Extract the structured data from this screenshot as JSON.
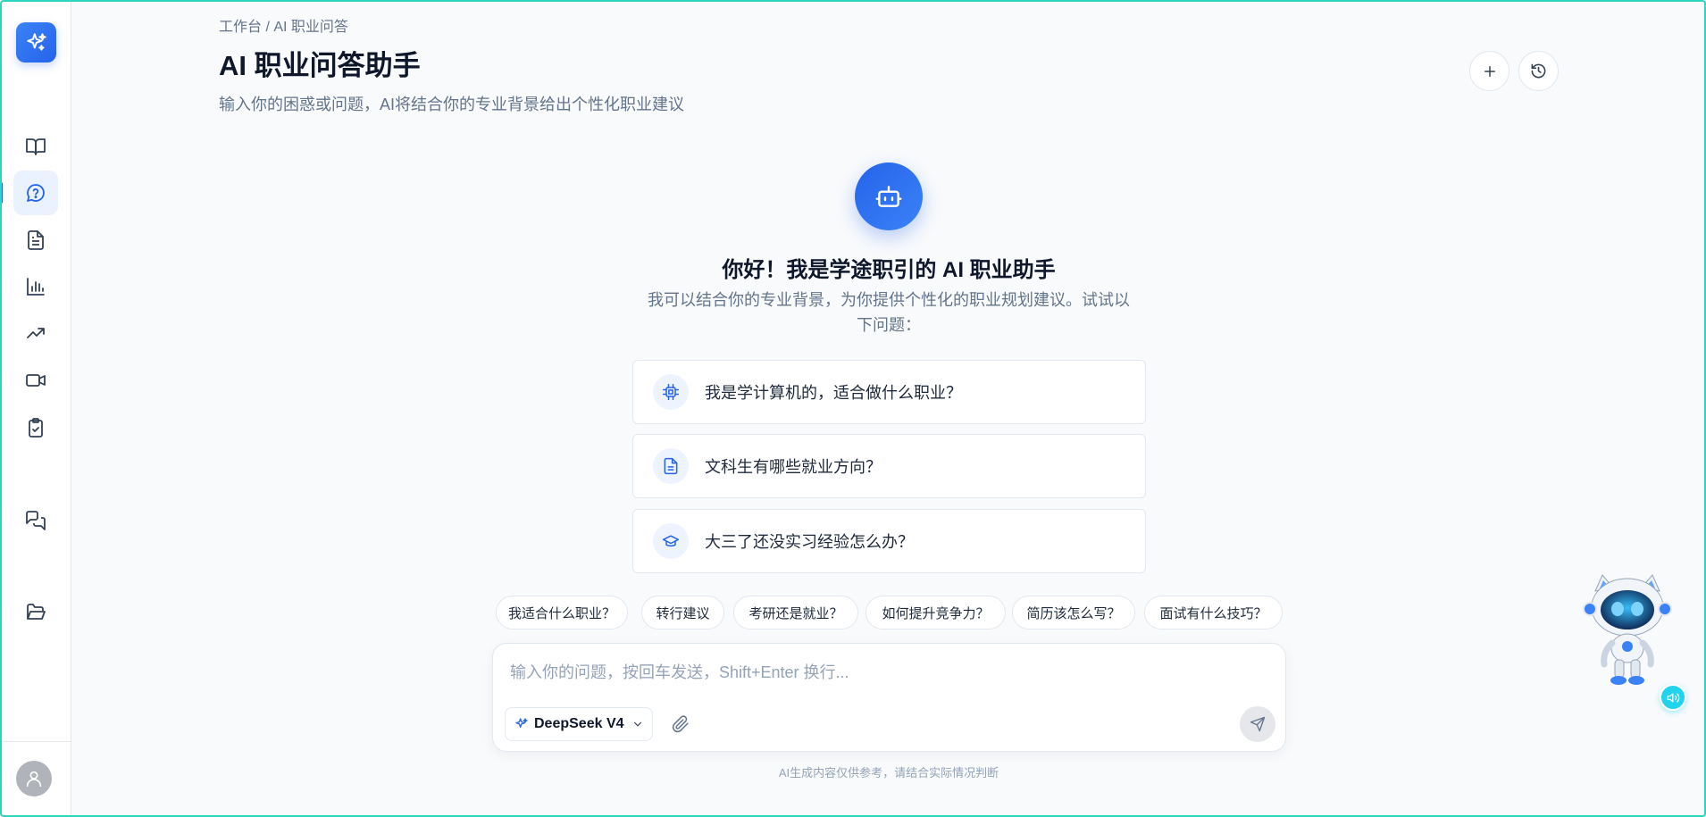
{
  "breadcrumb": "工作台 / AI 职业问答",
  "header": {
    "title": "AI 职业问答助手",
    "subtitle": "输入你的困惑或问题，AI将结合你的专业背景给出个性化职业建议"
  },
  "hero": {
    "title": "你好！我是学途职引的 AI 职业助手",
    "description": "我可以结合你的专业背景，为你提供个性化的职业规划建议。试试以下问题："
  },
  "suggestions": [
    {
      "icon": "cpu-icon",
      "text": "我是学计算机的，适合做什么职业？"
    },
    {
      "icon": "document-icon",
      "text": "文科生有哪些就业方向？"
    },
    {
      "icon": "graduation-cap-icon",
      "text": "大三了还没实习经验怎么办？"
    }
  ],
  "chips": [
    "我适合什么职业？",
    "转行建议",
    "考研还是就业？",
    "如何提升竞争力？",
    "简历该怎么写？",
    "面试有什么技巧？"
  ],
  "input": {
    "placeholder": "输入你的问题，按回车发送，Shift+Enter 换行...",
    "value": ""
  },
  "model": {
    "selected": "DeepSeek V4"
  },
  "disclaimer": "AI生成内容仅供参考，请结合实际情况判断",
  "sidebar": {
    "items": [
      {
        "icon": "book-open-icon",
        "active": false
      },
      {
        "icon": "help-chat-icon",
        "active": true
      },
      {
        "icon": "file-text-icon",
        "active": false
      },
      {
        "icon": "bar-chart-icon",
        "active": false
      },
      {
        "icon": "trending-up-icon",
        "active": false
      },
      {
        "icon": "video-icon",
        "active": false
      },
      {
        "icon": "clipboard-check-icon",
        "active": false
      },
      {
        "icon": "messages-icon",
        "active": false
      },
      {
        "icon": "folder-open-icon",
        "active": false
      }
    ]
  },
  "colors": {
    "accent": "#2563eb",
    "background": "#f8fafc",
    "frame": "#2dd4bf",
    "voice": "#22d3ee"
  }
}
